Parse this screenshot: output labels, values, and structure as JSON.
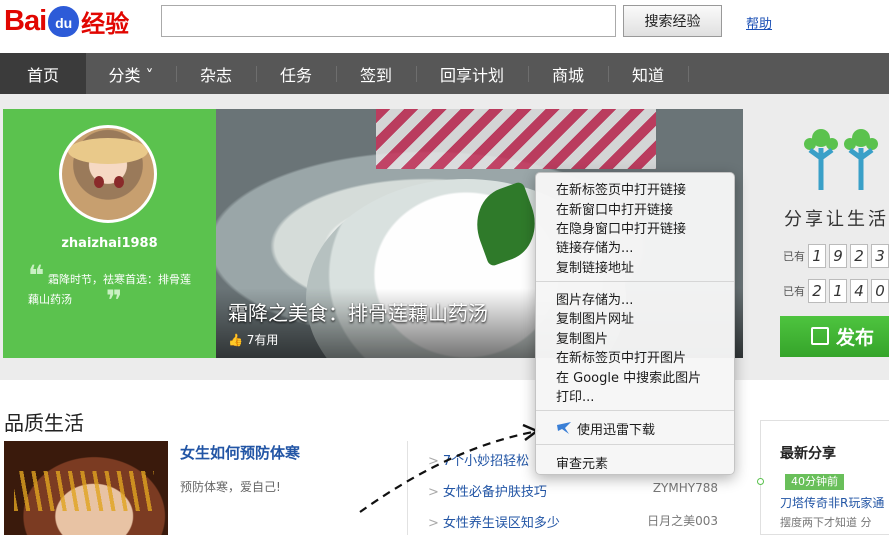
{
  "header": {
    "logo_bai": "Bai",
    "logo_du": "du",
    "logo_jingyan": "经验",
    "search_placeholder": "",
    "search_button": "搜索经验",
    "help": "帮助"
  },
  "nav": {
    "items": [
      {
        "label": "首页"
      },
      {
        "label": "分类 ˅"
      },
      {
        "label": "杂志"
      },
      {
        "label": "任务"
      },
      {
        "label": "签到"
      },
      {
        "label": "回享计划"
      },
      {
        "label": "商城"
      },
      {
        "label": "知道"
      }
    ]
  },
  "banner": {
    "username": "zhaizhai1988",
    "quote": "霜降时节，祛寒首选：排骨莲藕山药汤",
    "quote_open": "❝",
    "quote_close": "❞",
    "hero_title": "霜降之美食：排骨莲藕山药汤",
    "hero_likes": "7有用"
  },
  "share": {
    "slogan": "分享让生活",
    "row1_label": "已有",
    "row1_digits": [
      "1",
      "9",
      "2",
      "3"
    ],
    "row2_label": "已有",
    "row2_digits": [
      "2",
      "1",
      "4",
      "0"
    ],
    "publish_button": "发布"
  },
  "section": {
    "title": "品质生活",
    "article_title": "女生如何预防体寒",
    "article_desc": "预防体寒，爱自己!",
    "list": [
      {
        "title": "7个小妙招轻松",
        "author": ""
      },
      {
        "title": "女性必备护肤技巧",
        "author": "ZYMHY788"
      },
      {
        "title": "女性养生误区知多少",
        "author": "日月之美003"
      }
    ],
    "list_chevron": ">"
  },
  "latest": {
    "title": "最新分享",
    "time_badge": "40分钟前",
    "item": "刀塔传奇非R玩家通",
    "sub": "摆度两下才知道  分"
  },
  "context_menu": {
    "group1": [
      "在新标签页中打开链接",
      "在新窗口中打开链接",
      "在隐身窗口中打开链接",
      "链接存储为...",
      "复制链接地址"
    ],
    "group2": [
      "图片存储为...",
      "复制图片网址",
      "复制图片",
      "在新标签页中打开图片",
      "在 Google 中搜索此图片",
      "打印..."
    ],
    "thunder": "使用迅雷下载",
    "inspect": "审查元素"
  },
  "colors": {
    "brand_red": "#e10601",
    "brand_blue": "#2d5bd8",
    "nav_bg": "#575757",
    "green": "#5bc24e",
    "link_blue": "#2255a5"
  }
}
